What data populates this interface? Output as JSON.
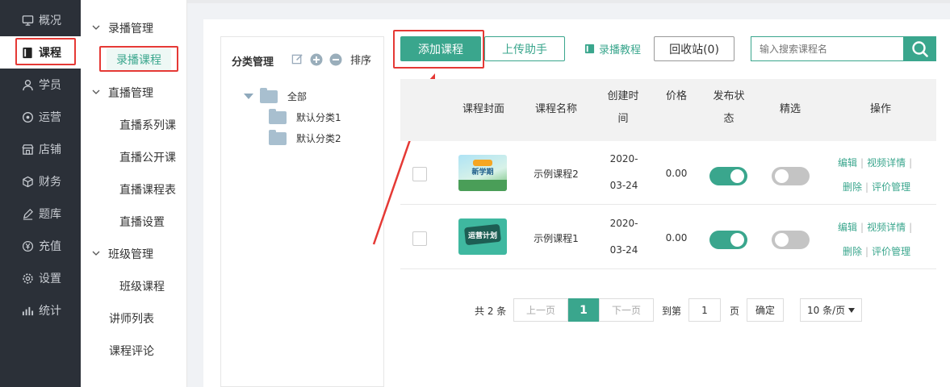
{
  "sidebar": {
    "items": [
      {
        "label": "概况",
        "icon": "dashboard-icon"
      },
      {
        "label": "课程",
        "icon": "book-icon",
        "active": true
      },
      {
        "label": "学员",
        "icon": "user-icon"
      },
      {
        "label": "运营",
        "icon": "location-icon"
      },
      {
        "label": "店铺",
        "icon": "shop-icon"
      },
      {
        "label": "财务",
        "icon": "finance-icon"
      },
      {
        "label": "题库",
        "icon": "pen-icon"
      },
      {
        "label": "充值",
        "icon": "yen-icon"
      },
      {
        "label": "设置",
        "icon": "gear-icon"
      },
      {
        "label": "统计",
        "icon": "bar-chart-icon"
      }
    ]
  },
  "submenu": {
    "group1": "录播管理",
    "group1_items": [
      "录播课程"
    ],
    "group2": "直播管理",
    "group2_items": [
      "直播系列课",
      "直播公开课",
      "直播课程表",
      "直播设置"
    ],
    "group3": "班级管理",
    "group3_items": [
      "班级课程"
    ],
    "plain": [
      "讲师列表",
      "课程评论"
    ]
  },
  "category": {
    "title": "分类管理",
    "sort": "排序",
    "root": "全部",
    "children": [
      "默认分类1",
      "默认分类2"
    ]
  },
  "toolbar": {
    "add_course": "添加课程",
    "upload_helper": "上传助手",
    "tutorial": "录播教程",
    "recycle": "回收站(0)",
    "search_placeholder": "输入搜索课程名"
  },
  "table": {
    "headers": [
      "课程封面",
      "课程名称",
      "创建时间",
      "价格",
      "发布状态",
      "精选",
      "操作"
    ],
    "rows": [
      {
        "name": "示例课程2",
        "date_line1": "2020-",
        "date_line2": "03-24",
        "price": "0.00",
        "published": true,
        "featured": false,
        "cover_text": "新学期"
      },
      {
        "name": "示例课程1",
        "date_line1": "2020-",
        "date_line2": "03-24",
        "price": "0.00",
        "published": true,
        "featured": false,
        "cover_text": "运营计划"
      }
    ],
    "ops": {
      "edit": "编辑",
      "video": "视频详情",
      "delete": "删除",
      "review": "评价管理"
    }
  },
  "pagination": {
    "total": "共 2 条",
    "prev": "上一页",
    "current": "1",
    "next": "下一页",
    "goto": "到第",
    "page_value": "1",
    "page_unit": "页",
    "confirm": "确定",
    "page_size": "10 条/页"
  },
  "colors": {
    "accent": "#3aa68d",
    "sidebar_bg": "#2b3038",
    "highlight": "#e53935"
  }
}
